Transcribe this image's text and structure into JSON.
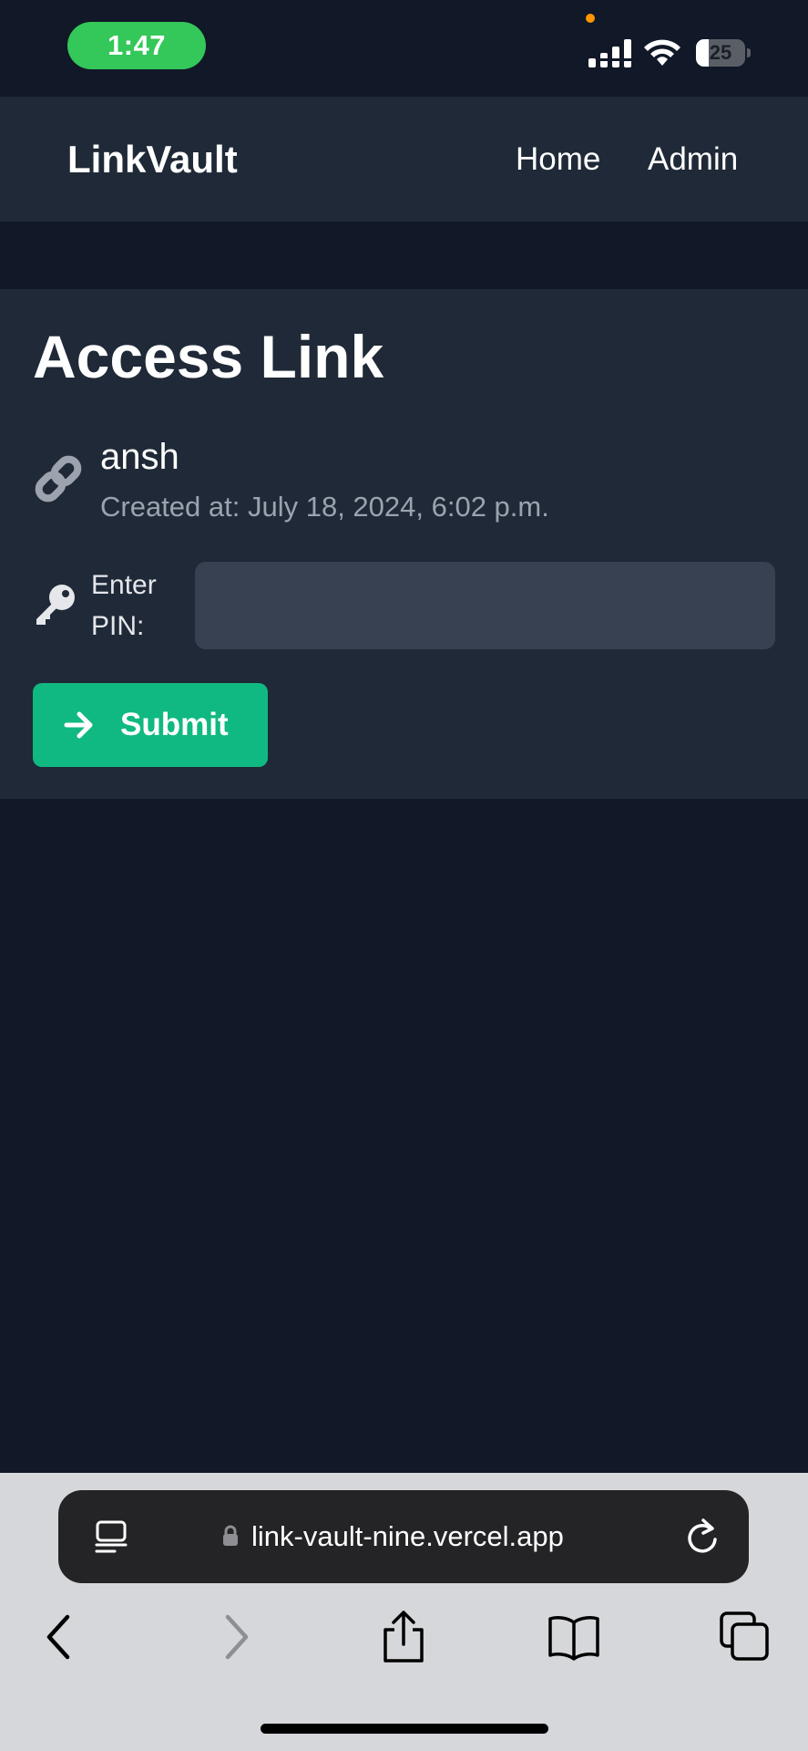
{
  "status_bar": {
    "time": "1:47",
    "battery_level": "25",
    "battery_fraction": 0.25
  },
  "navbar": {
    "brand": "LinkVault",
    "links": [
      "Home",
      "Admin"
    ]
  },
  "access_card": {
    "title": "Access Link",
    "link_name": "ansh",
    "created_at": "Created at: July 18, 2024, 6:02 p.m.",
    "pin_label": "Enter PIN:",
    "pin_value": "",
    "submit_label": "Submit"
  },
  "browser": {
    "url": "link-vault-nine.vercel.app"
  },
  "colors": {
    "page_background": "#111827",
    "card_background": "#1f2937",
    "input_background": "#374151",
    "accent": "#10b981",
    "muted_text": "#9ca3af",
    "status_time_pill": "#34c759"
  },
  "icons": {
    "link": "link-icon",
    "pin": "key-icon",
    "submit": "arrow-right-icon",
    "tabs_overview": "tab-overview-icon",
    "lock": "lock-icon",
    "reload": "reload-icon",
    "back": "chevron-left-icon",
    "forward": "chevron-right-icon",
    "share": "share-icon",
    "bookmarks": "book-icon",
    "tabs": "tabs-icon"
  }
}
